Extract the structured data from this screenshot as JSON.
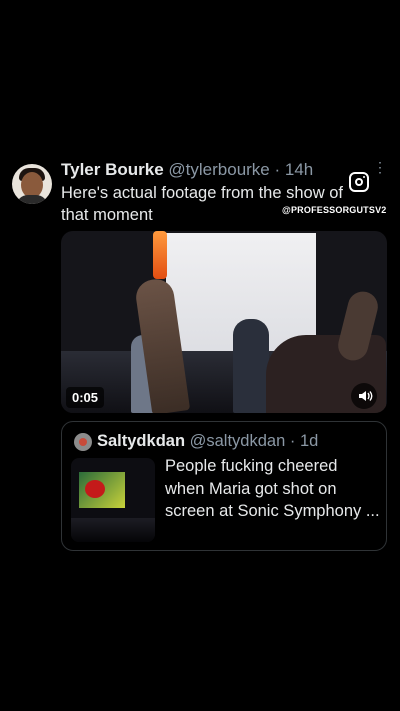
{
  "tweet": {
    "author_name": "Tyler Bourke",
    "author_handle": "@tylerbourke",
    "age": "· 14h",
    "more_glyph": "⋮",
    "text": "Here's actual footage from the show of that moment"
  },
  "overlay": {
    "watermark": "@PROFESSORGUTSV2",
    "icon": "instagram-icon"
  },
  "video": {
    "duration": "0:05",
    "sound_icon": "speaker-icon"
  },
  "quoted_tweet": {
    "author_name": "Saltydkdan",
    "author_handle": "@saltydkdan",
    "age": "· 1d",
    "text": "People fucking cheered when Maria got shot on screen at Sonic Symphony ..."
  },
  "colors": {
    "background": "#000000",
    "text_primary": "#e7e9ea",
    "text_secondary": "#8b98a5",
    "border": "#2f3336"
  }
}
